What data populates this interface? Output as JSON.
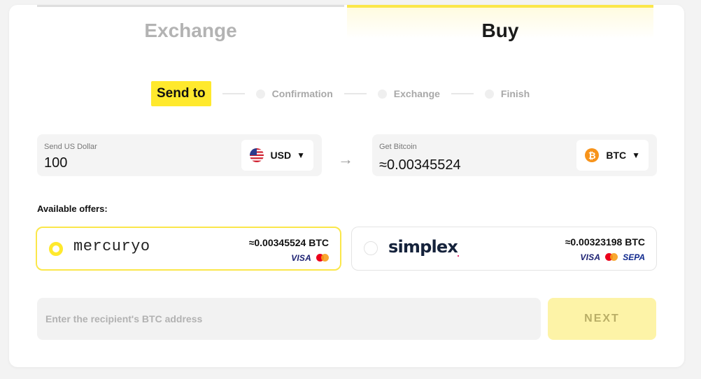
{
  "tabs": {
    "exchange": "Exchange",
    "buy": "Buy"
  },
  "stepper": {
    "active": "Send to",
    "steps": [
      "Confirmation",
      "Exchange",
      "Finish"
    ]
  },
  "send": {
    "label": "Send US Dollar",
    "value": "100",
    "currency": "USD",
    "currency_icon": "us-flag-icon"
  },
  "get": {
    "label": "Get Bitcoin",
    "value": "≈0.00345524",
    "currency": "BTC",
    "currency_icon": "bitcoin-icon"
  },
  "offers": {
    "title": "Available offers:",
    "items": [
      {
        "provider": "mercuryo",
        "amount": "≈0.00345524 BTC",
        "payment_methods": [
          "VISA",
          "mastercard"
        ],
        "selected": true
      },
      {
        "provider": "simplex",
        "amount": "≈0.00323198 BTC",
        "payment_methods": [
          "VISA",
          "mastercard",
          "SEPA"
        ],
        "selected": false
      }
    ]
  },
  "address": {
    "placeholder": "Enter the recipient's BTC address",
    "value": ""
  },
  "next_button": "NEXT",
  "colors": {
    "accent": "#ffe92d",
    "accent_light": "#fdf3a7",
    "muted_text": "#b3b3b3",
    "field_bg": "#f4f4f4"
  }
}
